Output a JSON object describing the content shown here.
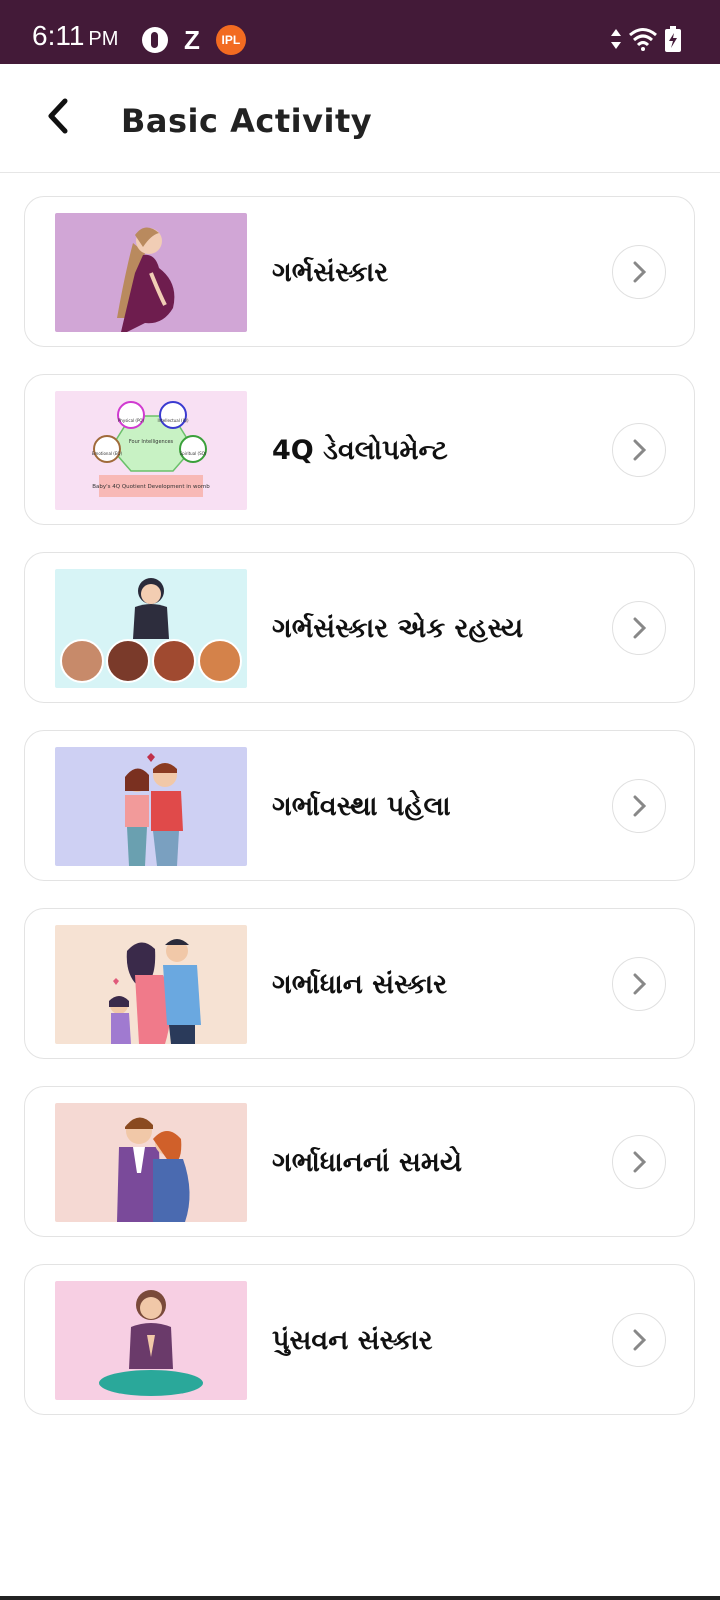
{
  "status_bar": {
    "time": "6:11",
    "ampm": "PM",
    "background": "#431a38",
    "icons_left": [
      "pocketcasts-icon",
      "z-icon",
      "ipl-icon"
    ],
    "ipl_label": "IPL",
    "icons_right": [
      "data-arrows-icon",
      "wifi-icon",
      "battery-charging-icon"
    ]
  },
  "app_bar": {
    "back_icon": "back-arrow-icon",
    "title": "Basic Activity"
  },
  "items": [
    {
      "label": "ગર્ભસંસ્કાર",
      "image": "pregnant-woman-illustration",
      "bg": "#d1a6d6"
    },
    {
      "label": "4Q ડેવલોપમેન્ટ",
      "image": "four-q-development-diagram",
      "bg": "#f8e0f3",
      "image_texts": {
        "center": "Four Intelligences",
        "caption": "Baby's 4Q Quotient Development in womb",
        "n1": "Physical (PQ)",
        "n2": "Intellectual (IQ)",
        "n3": "Spiritual (SQ)",
        "n4": "Emotional (EQ)"
      }
    },
    {
      "label": "ગર્ભસંસ્કાર એક રહસ્ય",
      "image": "meditation-woman-portraits",
      "bg": "#d7f4f6"
    },
    {
      "label": "ગર્ભાવસ્થા પહેલા",
      "image": "couple-illustration",
      "bg": "#ced0f3"
    },
    {
      "label": "ગર્ભાધાન સંસ્કાર",
      "image": "family-illustration",
      "bg": "#f6e2d3"
    },
    {
      "label": "ગર્ભાધાનનાં સમયે",
      "image": "expecting-couple-illustration",
      "bg": "#f5d9d3"
    },
    {
      "label": "પુંસવન સંસ્કાર",
      "image": "yoga-woman-illustration",
      "bg": "#f7cfe3"
    }
  ]
}
